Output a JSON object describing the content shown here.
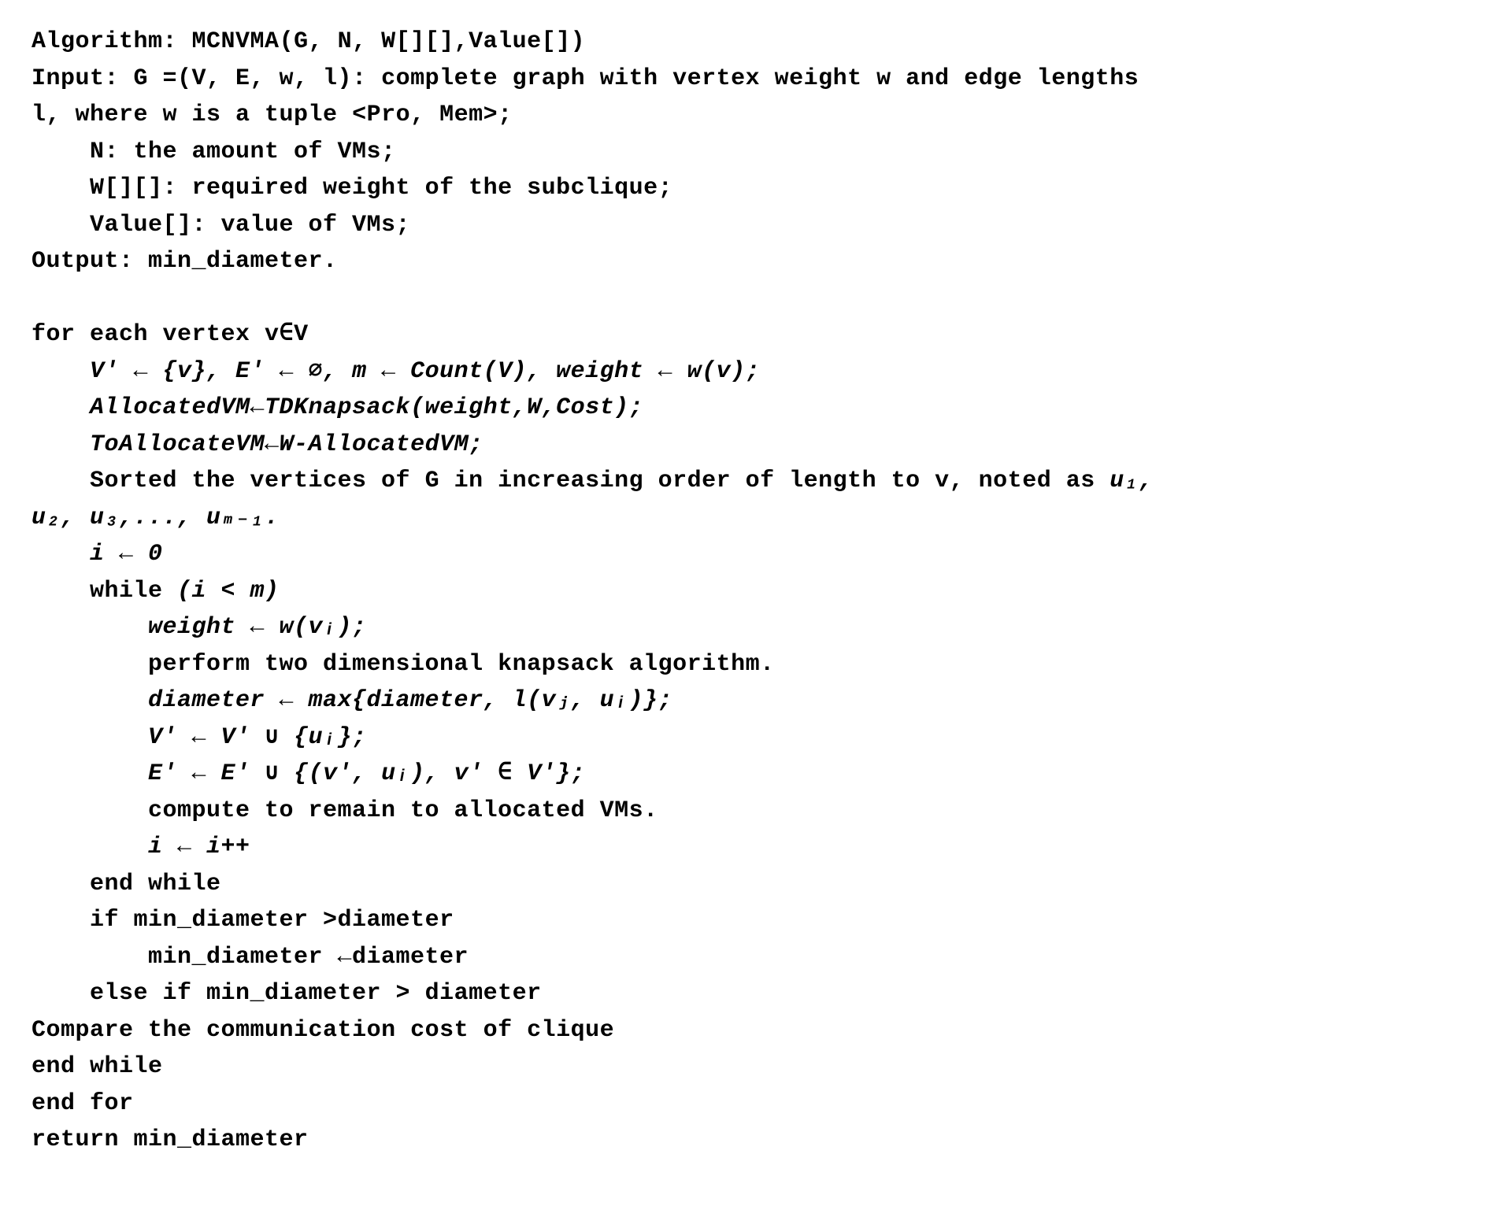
{
  "lines": {
    "l01a": "Algorithm: ",
    "l01b": "MCNVMA(G, N, W[][],Value[])",
    "l02": "Input: G =(V, E, w, l): complete graph with vertex weight w and edge lengths",
    "l03": "l, where w is a tuple <Pro, Mem>;",
    "l04": "N: the amount of VMs;",
    "l05": "W[][]: required weight of the subclique;",
    "l06": "Value[]: value of VMs;",
    "l07": "Output: min_diameter.",
    "l09": "for each vertex v∈V",
    "l10": "V' ← {v}, E' ← ∅, m ← Count(V), weight ← w(v);",
    "l11": "AllocatedVM←TDKnapsack(weight,W,Cost);",
    "l12": "ToAllocateVM←W-AllocatedVM;",
    "l13a": "Sorted the vertices of G in increasing order of length to v, noted as ",
    "l13b": "u₁,",
    "l14": "u₂, u₃,..., uₘ₋₁.",
    "l15": "i ← 0",
    "l16a": "while ",
    "l16b": "(i < m)",
    "l17": "weight ← w(vᵢ);",
    "l18": "perform two dimensional knapsack algorithm.",
    "l19": "diameter ← max{diameter, l(vⱼ, uᵢ)};",
    "l20": "V' ← V' ∪ {uᵢ};",
    "l21": "E' ← E' ∪ {(v', uᵢ), v' ∈ V'};",
    "l22": "compute to remain to allocated VMs.",
    "l23": "i ← i++",
    "l24": "end while",
    "l25": "if min_diameter >diameter",
    "l26": "min_diameter ←diameter",
    "l27": "else if min_diameter > diameter",
    "l28": "Compare the communication cost of clique",
    "l29": "end while",
    "l30": "end for",
    "l31": "return min_diameter"
  }
}
